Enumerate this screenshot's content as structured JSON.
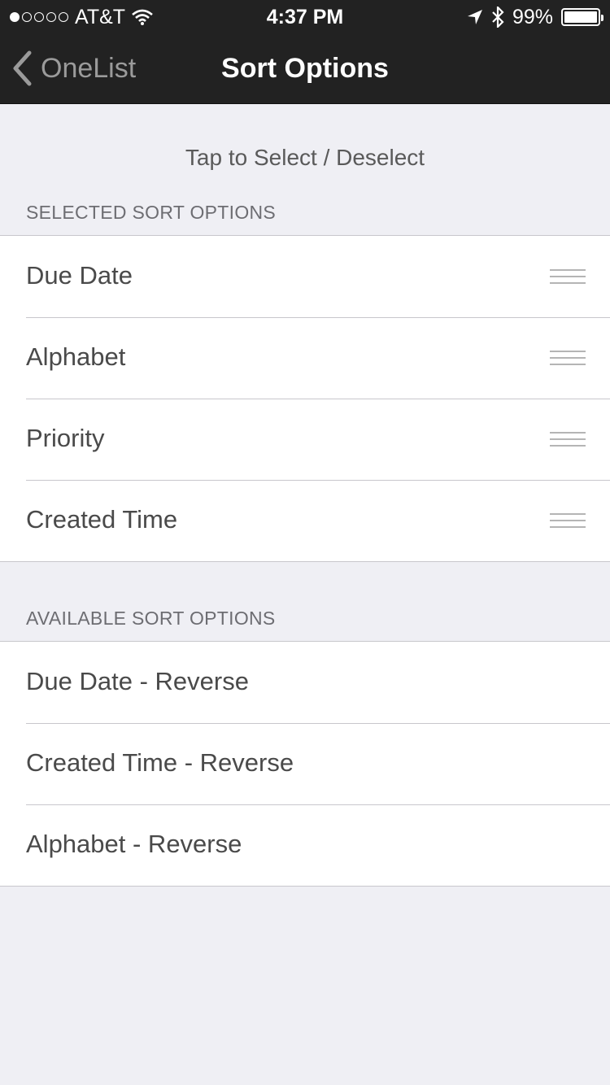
{
  "status_bar": {
    "carrier": "AT&T",
    "time": "4:37 PM",
    "battery": "99%",
    "signal_bars": 1,
    "icons": [
      "signal-dots-icon",
      "wifi-icon",
      "location-arrow-icon",
      "bluetooth-icon",
      "battery-icon"
    ]
  },
  "nav": {
    "back_label": "OneList",
    "title": "Sort Options"
  },
  "hint": "Tap to Select / Deselect",
  "selected": {
    "header": "SELECTED SORT OPTIONS",
    "items": [
      {
        "label": "Due Date"
      },
      {
        "label": "Alphabet"
      },
      {
        "label": "Priority"
      },
      {
        "label": "Created Time"
      }
    ]
  },
  "available": {
    "header": "AVAILABLE SORT OPTIONS",
    "items": [
      {
        "label": "Due Date - Reverse"
      },
      {
        "label": "Created Time - Reverse"
      },
      {
        "label": "Alphabet - Reverse"
      }
    ]
  },
  "colors": {
    "nav_background": "#222222",
    "page_background": "#efeff4",
    "row_background": "#ffffff",
    "separator": "#c8c7cc"
  }
}
